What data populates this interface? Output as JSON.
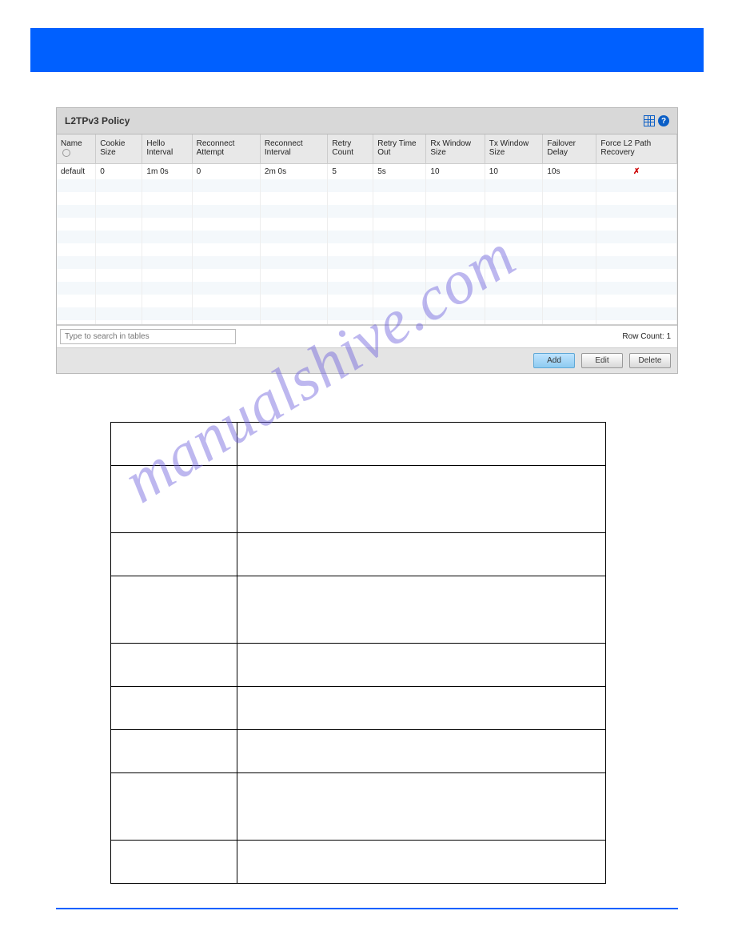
{
  "panel": {
    "title": "L2TPv3 Policy"
  },
  "table": {
    "headers": {
      "name": "Name",
      "cookie_size": "Cookie Size",
      "hello_interval": "Hello Interval",
      "reconnect_attempt": "Reconnect Attempt",
      "reconnect_interval": "Reconnect Interval",
      "retry_count": "Retry Count",
      "retry_timeout": "Retry Time Out",
      "rx_window": "Rx Window Size",
      "tx_window": "Tx Window Size",
      "failover_delay": "Failover Delay",
      "force_l2": "Force L2  Path Recovery"
    },
    "rows": [
      {
        "name": "default",
        "cookie_size": "0",
        "hello_interval": "1m 0s",
        "reconnect_attempt": "0",
        "reconnect_interval": "2m 0s",
        "retry_count": "5",
        "retry_timeout": "5s",
        "rx_window": "10",
        "tx_window": "10",
        "failover_delay": "10s",
        "force_l2": "✗"
      }
    ]
  },
  "search": {
    "placeholder": "Type to search in tables"
  },
  "footer": {
    "row_count_label": "Row Count:",
    "row_count_value": "1"
  },
  "buttons": {
    "add": "Add",
    "edit": "Edit",
    "delete": "Delete"
  },
  "watermark": "manualshive.com"
}
